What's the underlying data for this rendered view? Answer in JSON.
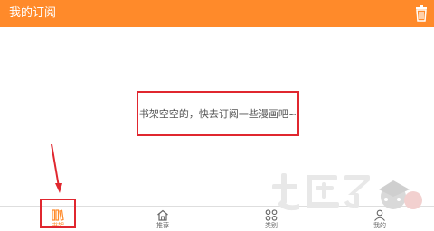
{
  "header": {
    "title": "我的订阅"
  },
  "empty_state": {
    "message": "书架空空的，快去订阅一些漫画吧~"
  },
  "tabs": [
    {
      "label": "书架",
      "icon": "bookshelf-icon",
      "active": true
    },
    {
      "label": "推荐",
      "icon": "home-icon",
      "active": false
    },
    {
      "label": "类别",
      "icon": "grid-icon",
      "active": false
    },
    {
      "label": "我的",
      "icon": "user-icon",
      "active": false
    }
  ],
  "colors": {
    "accent": "#ff8a2a",
    "highlight": "#e0272f"
  }
}
